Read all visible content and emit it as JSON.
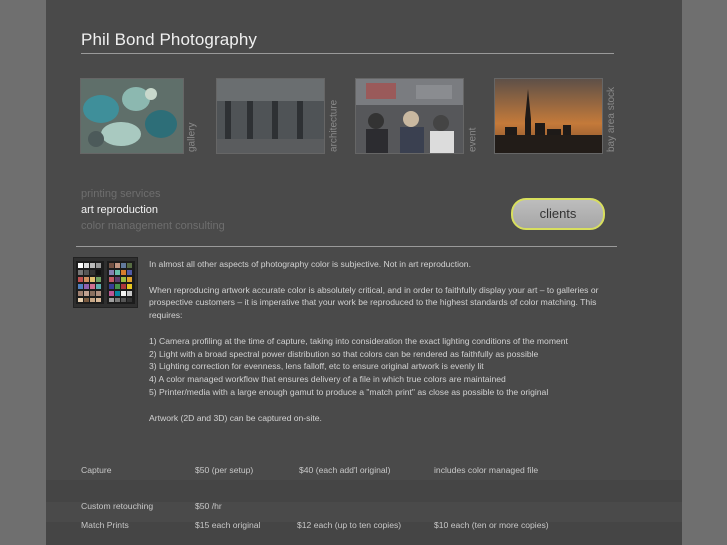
{
  "site_title": "Phil Bond Photography",
  "gallery": [
    {
      "label": "gallery",
      "image": "glass-figurines-photo"
    },
    {
      "label": "architecture",
      "image": "building-interior-photo"
    },
    {
      "label": "event",
      "image": "event-crowd-photo"
    },
    {
      "label": "bay area stock",
      "image": "city-skyline-sunset-photo"
    }
  ],
  "services": {
    "items": [
      "printing services",
      "art reproduction",
      "color management consulting"
    ],
    "active": "art reproduction"
  },
  "clients_button": "clients",
  "content": {
    "intro": "In almost all other aspects of photography color is subjective. Not in art reproduction.",
    "para": "When reproducing artwork accurate color is absolutely critical, and in order to faithfully display your art – to galleries or prospective customers – it is imperative that your work be reproduced to the highest standards of color matching. This requires:",
    "requirements": [
      "1)  Camera profiling at the time of capture, taking into consideration the exact lighting conditions of the moment",
      "2)  Light with a broad spectral power distribution so that colors can be rendered as faithfully as possible",
      "3)  Lighting correction for evenness, lens falloff, etc to ensure original artwork is evenly lit",
      "4)  A color managed workflow that ensures delivery of a file in which true colors are maintained",
      "5)  Printer/media with a large enough gamut to produce a \"match print\" as close as possible to the original"
    ],
    "onsite": "Artwork (2D and 3D) can be captured on-site."
  },
  "pricing": [
    {
      "service": "Capture",
      "c1": "$50 (per setup)",
      "c2": "$40 (each add'l original)",
      "c3": "includes color managed file"
    },
    {
      "service": "Custom retouching",
      "c1": "$50 /hr",
      "c2": "",
      "c3": ""
    },
    {
      "service": "Match Prints",
      "c1": "$15 each original",
      "c2": "$12 each (up to ten copies)",
      "c3": "$10 each (ten or more copies)"
    }
  ],
  "colors": {
    "page_background": "#6f6f6f",
    "content_background": "#4a4a4a",
    "button_border": "#d8df5e"
  }
}
